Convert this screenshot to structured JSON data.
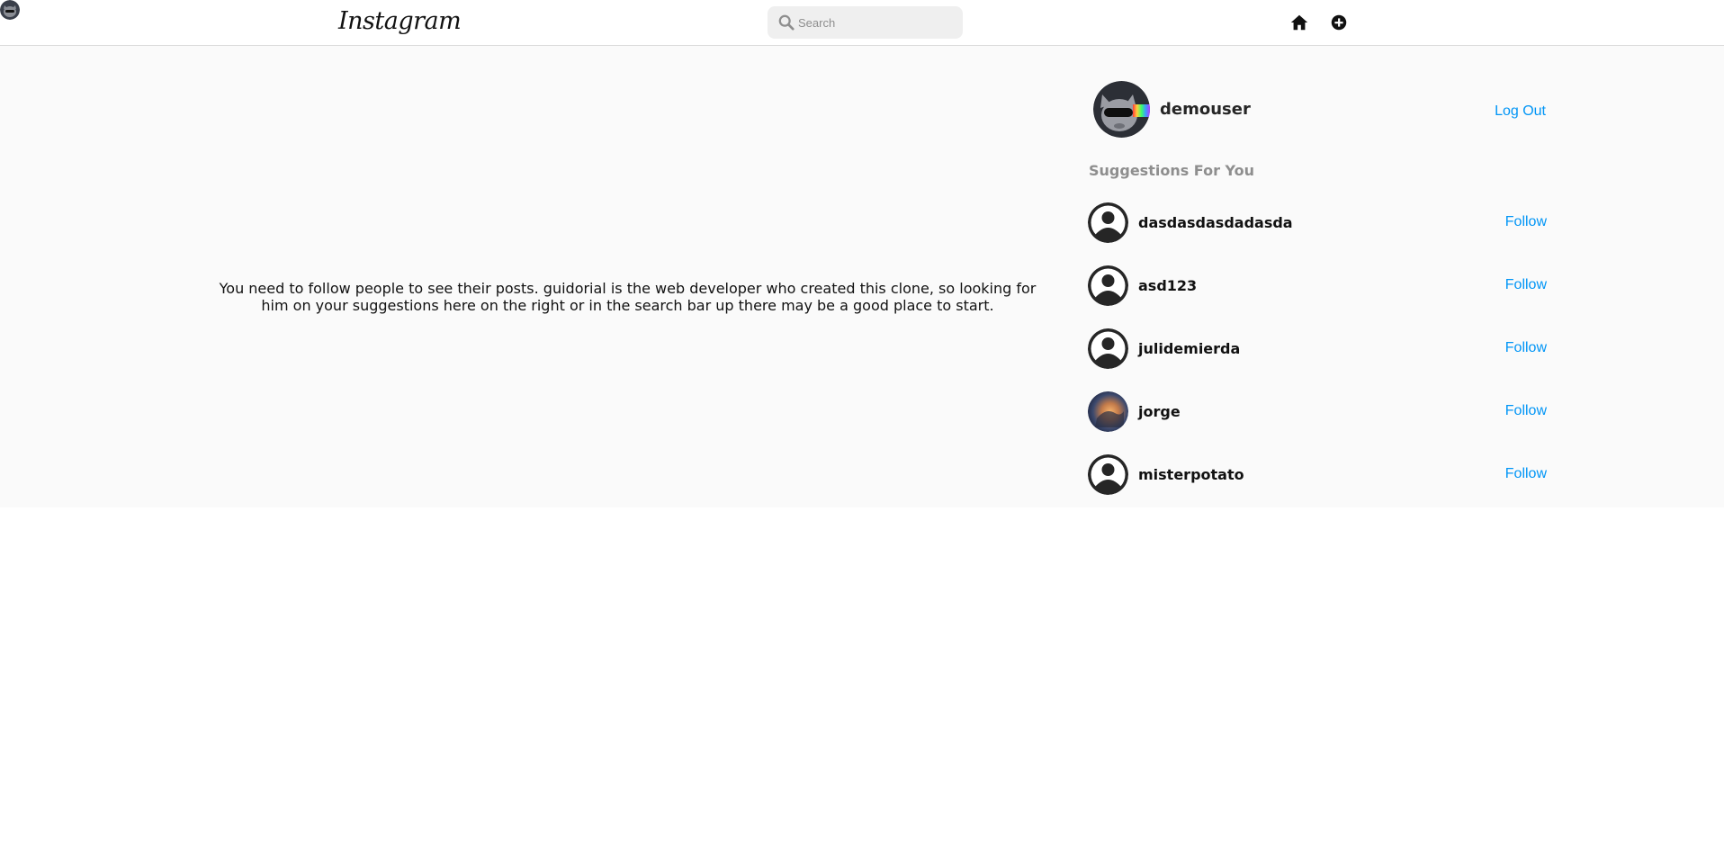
{
  "header": {
    "logo": "Instagram",
    "search_placeholder": "Search",
    "icons": [
      "home-icon",
      "add-post-icon",
      "profile-avatar-icon"
    ]
  },
  "feed": {
    "message": "You need to follow people to see their posts. guidorial is the web developer who created this clone, so looking for him on your suggestions here on the right or in the search bar up there may be a good place to start."
  },
  "sidebar": {
    "username": "demouser",
    "logout_label": "Log Out",
    "suggestions_title": "Suggestions For You",
    "suggestions": [
      {
        "username": "dasdasdasdadasda",
        "follow_label": "Follow",
        "avatar": "default"
      },
      {
        "username": "asd123",
        "follow_label": "Follow",
        "avatar": "default"
      },
      {
        "username": "julidemierda",
        "follow_label": "Follow",
        "avatar": "default"
      },
      {
        "username": "jorge",
        "follow_label": "Follow",
        "avatar": "photo"
      },
      {
        "username": "misterpotato",
        "follow_label": "Follow",
        "avatar": "default"
      }
    ]
  },
  "colors": {
    "accent": "#0095f6",
    "background": "#fafafa",
    "muted": "#8e8e8e"
  }
}
